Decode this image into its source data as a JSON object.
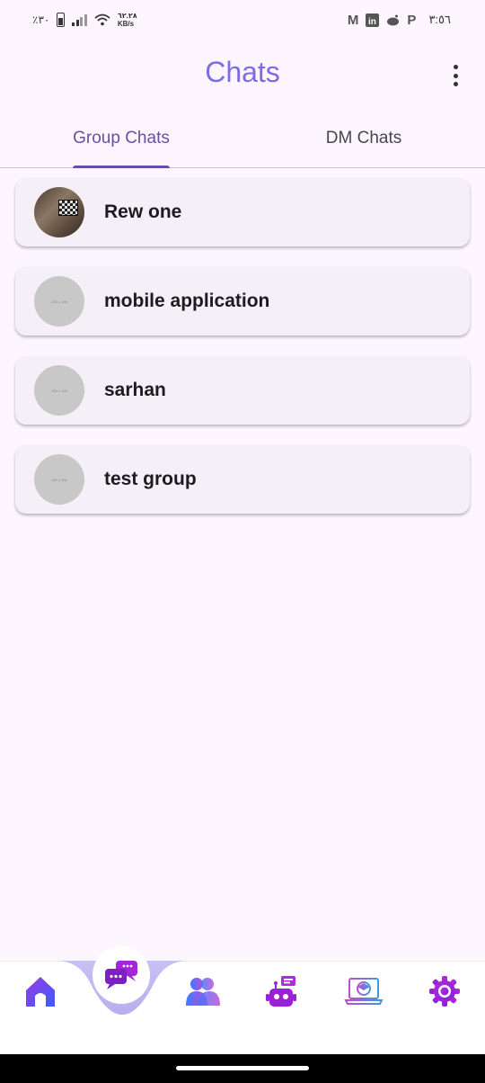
{
  "status_bar": {
    "battery": "٪٣٠",
    "speed_value": "٦٢.٢٨",
    "speed_unit": "KB/s",
    "time": "٣:٥٦",
    "notification_icons": [
      "gmail-icon",
      "linkedin-icon",
      "reddit-icon",
      "paypal-icon"
    ]
  },
  "header": {
    "title": "Chats"
  },
  "tabs": [
    {
      "label": "Group Chats",
      "active": true
    },
    {
      "label": "DM Chats",
      "active": false
    }
  ],
  "chats": [
    {
      "name": "Rew one",
      "avatar": "photo"
    },
    {
      "name": "mobile application",
      "avatar": "placeholder"
    },
    {
      "name": "sarhan",
      "avatar": "placeholder"
    },
    {
      "name": "test group",
      "avatar": "placeholder"
    }
  ],
  "bottom_nav": {
    "items": [
      "home-icon",
      "chat-icon",
      "groups-icon",
      "bot-icon",
      "learning-icon",
      "settings-icon"
    ],
    "active": "chat-icon"
  },
  "colors": {
    "accent": "#6750A4",
    "background": "#FDF6FE",
    "card": "#F5EFF7",
    "title_gradient_start": "#4A8CF0",
    "title_gradient_end": "#A94BE0",
    "nav_curve": "#BDB3F2"
  }
}
